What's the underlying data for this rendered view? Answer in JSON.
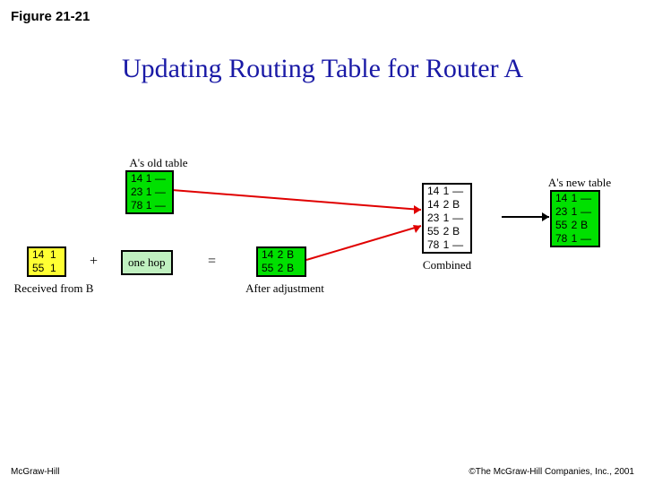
{
  "figure_label": "Figure 21-21",
  "title": "Updating Routing Table for Router A",
  "captions": {
    "old": "A's old table",
    "received": "Received from B",
    "onehop": "one hop",
    "after": "After adjustment",
    "combined": "Combined",
    "new": "A's new table"
  },
  "ops": {
    "plus": "+",
    "equals": "="
  },
  "tables": {
    "old": [
      [
        "14",
        "1",
        "—"
      ],
      [
        "23",
        "1",
        "—"
      ],
      [
        "78",
        "1",
        "—"
      ]
    ],
    "received": [
      [
        "14",
        "1",
        ""
      ],
      [
        "55",
        "1",
        ""
      ]
    ],
    "adjusted": [
      [
        "14",
        "2",
        "B"
      ],
      [
        "55",
        "2",
        "B"
      ]
    ],
    "combined": [
      [
        "14",
        "1",
        "—"
      ],
      [
        "14",
        "2",
        "B"
      ],
      [
        "23",
        "1",
        "—"
      ],
      [
        "55",
        "2",
        "B"
      ],
      [
        "78",
        "1",
        "—"
      ]
    ],
    "new": [
      [
        "14",
        "1",
        "—"
      ],
      [
        "23",
        "1",
        "—"
      ],
      [
        "55",
        "2",
        "B"
      ],
      [
        "78",
        "1",
        "—"
      ]
    ]
  },
  "footer": {
    "left": "McGraw-Hill",
    "right": "©The McGraw-Hill Companies, Inc., 2001"
  }
}
